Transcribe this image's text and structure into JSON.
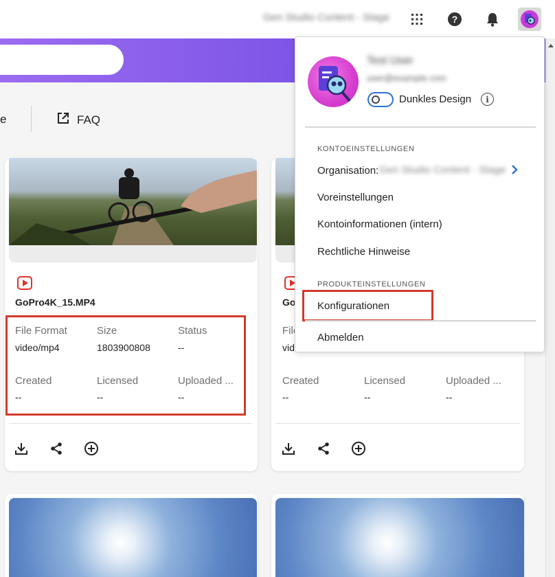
{
  "topbar": {
    "org_name": "Gen Studio Content - Stage",
    "icons": [
      "apps-grid-icon",
      "help-icon",
      "bell-icon",
      "avatar"
    ]
  },
  "toolbar": {
    "partial_label": "e",
    "faq_label": "FAQ"
  },
  "cards": [
    {
      "file_name": "GoPro4K_15.MP4",
      "meta": [
        {
          "label": "File Format",
          "value": "video/mp4"
        },
        {
          "label": "Size",
          "value": "1803900808"
        },
        {
          "label": "Status",
          "value": "--"
        },
        {
          "label": "Created",
          "value": "--"
        },
        {
          "label": "Licensed",
          "value": "--"
        },
        {
          "label": "Uploaded ...",
          "value": "--"
        }
      ]
    },
    {
      "file_name": "Go",
      "meta": [
        {
          "label": "File",
          "value": "vid"
        },
        {
          "label": "Created",
          "value": "--"
        },
        {
          "label": "Licensed",
          "value": "--"
        },
        {
          "label": "Uploaded ...",
          "value": "--"
        }
      ]
    }
  ],
  "dropdown": {
    "user_name": "Test User",
    "user_email": "user@example.com",
    "dark_mode_label": "Dunkles Design",
    "dark_mode_on": false,
    "account_section": "KONTOEINSTELLUNGEN",
    "org_label": "Organisation:",
    "org_value": "Gen Studio Content - Stage",
    "items": [
      "Voreinstellungen",
      "Kontoinformationen (intern)",
      "Rechtliche Hinweise"
    ],
    "product_section": "PRODUKTEINSTELLUNGEN",
    "config_label": "Konfigurationen",
    "logout_label": "Abmelden"
  },
  "colors": {
    "accent": "#7a52e6",
    "highlight": "#d23a2c",
    "play_badge": "#e0312d",
    "avatar": "#d83ed0"
  }
}
